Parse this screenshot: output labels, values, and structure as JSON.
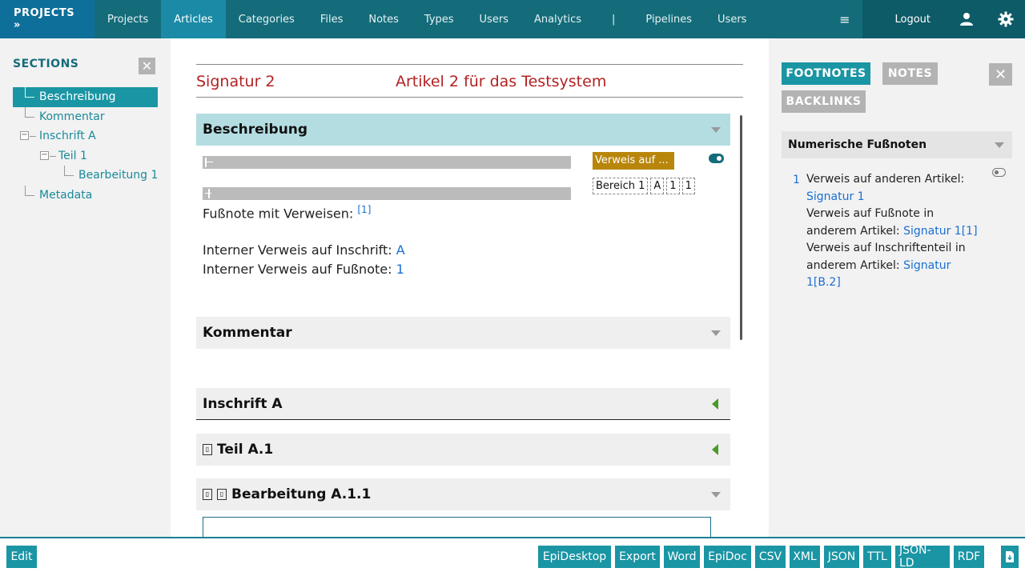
{
  "nav": {
    "brand": "PROJECTS »",
    "items": [
      "Projects",
      "Articles",
      "Categories",
      "Files",
      "Notes",
      "Types",
      "Users",
      "Analytics",
      "|",
      "Pipelines",
      "Users"
    ],
    "hamburger": "≡",
    "logout": "Logout"
  },
  "sidebar": {
    "title": "SECTIONS",
    "close": "✕",
    "tree": [
      "Beschreibung",
      "Kommentar",
      "Inschrift A",
      "Teil 1",
      "Bearbeitung 1",
      "Metadata"
    ]
  },
  "doc": {
    "signature": "Signatur 2",
    "title": "Artikel 2 für das Testsystem",
    "sections": {
      "beschreibung": "Beschreibung",
      "kommentar": "Kommentar",
      "inschrift": "Inschrift A",
      "teil": "Teil A.1",
      "bearbeitung": "Bearbeitung A.1.1"
    },
    "footnote_text": "Fußnote mit Verweisen:",
    "footnote_ref": "[1]",
    "internal_inscr_label": "Interner Verweis auf Inschrift:",
    "internal_inscr_link": "A",
    "internal_fn_label": "Interner Verweis auf Fußnote:",
    "internal_fn_link": "1",
    "annotation": "Verweis auf ...",
    "chips": [
      "Bereich 1",
      "A",
      "1",
      "1"
    ]
  },
  "rpanel": {
    "tabs": [
      "FOOTNOTES",
      "NOTES",
      "BACKLINKS"
    ],
    "close": "✕",
    "heading": "Numerische Fußnoten",
    "footnote": {
      "number": "1",
      "line1": "Verweis auf anderen Artikel:",
      "link1": "Signatur 1",
      "line2": "Verweis auf Fußnote in anderem Artikel:",
      "link2": "Signatur 1[1]",
      "line3": "Verweis auf Inschriftenteil in anderem Artikel:",
      "link3": "Signatur 1[B.2]"
    }
  },
  "footer": {
    "edit": "Edit",
    "buttons": [
      "EpiDesktop",
      "Export",
      "Word",
      "EpiDoc",
      "CSV",
      "XML",
      "JSON",
      "TTL",
      "JSON-LD",
      "RDF"
    ]
  },
  "colors": {
    "nav_bg": "#146c7a",
    "accent": "#1a95a4",
    "title_red": "#b22222",
    "link_blue": "#1a6fd1",
    "annotation": "#b8860b"
  }
}
